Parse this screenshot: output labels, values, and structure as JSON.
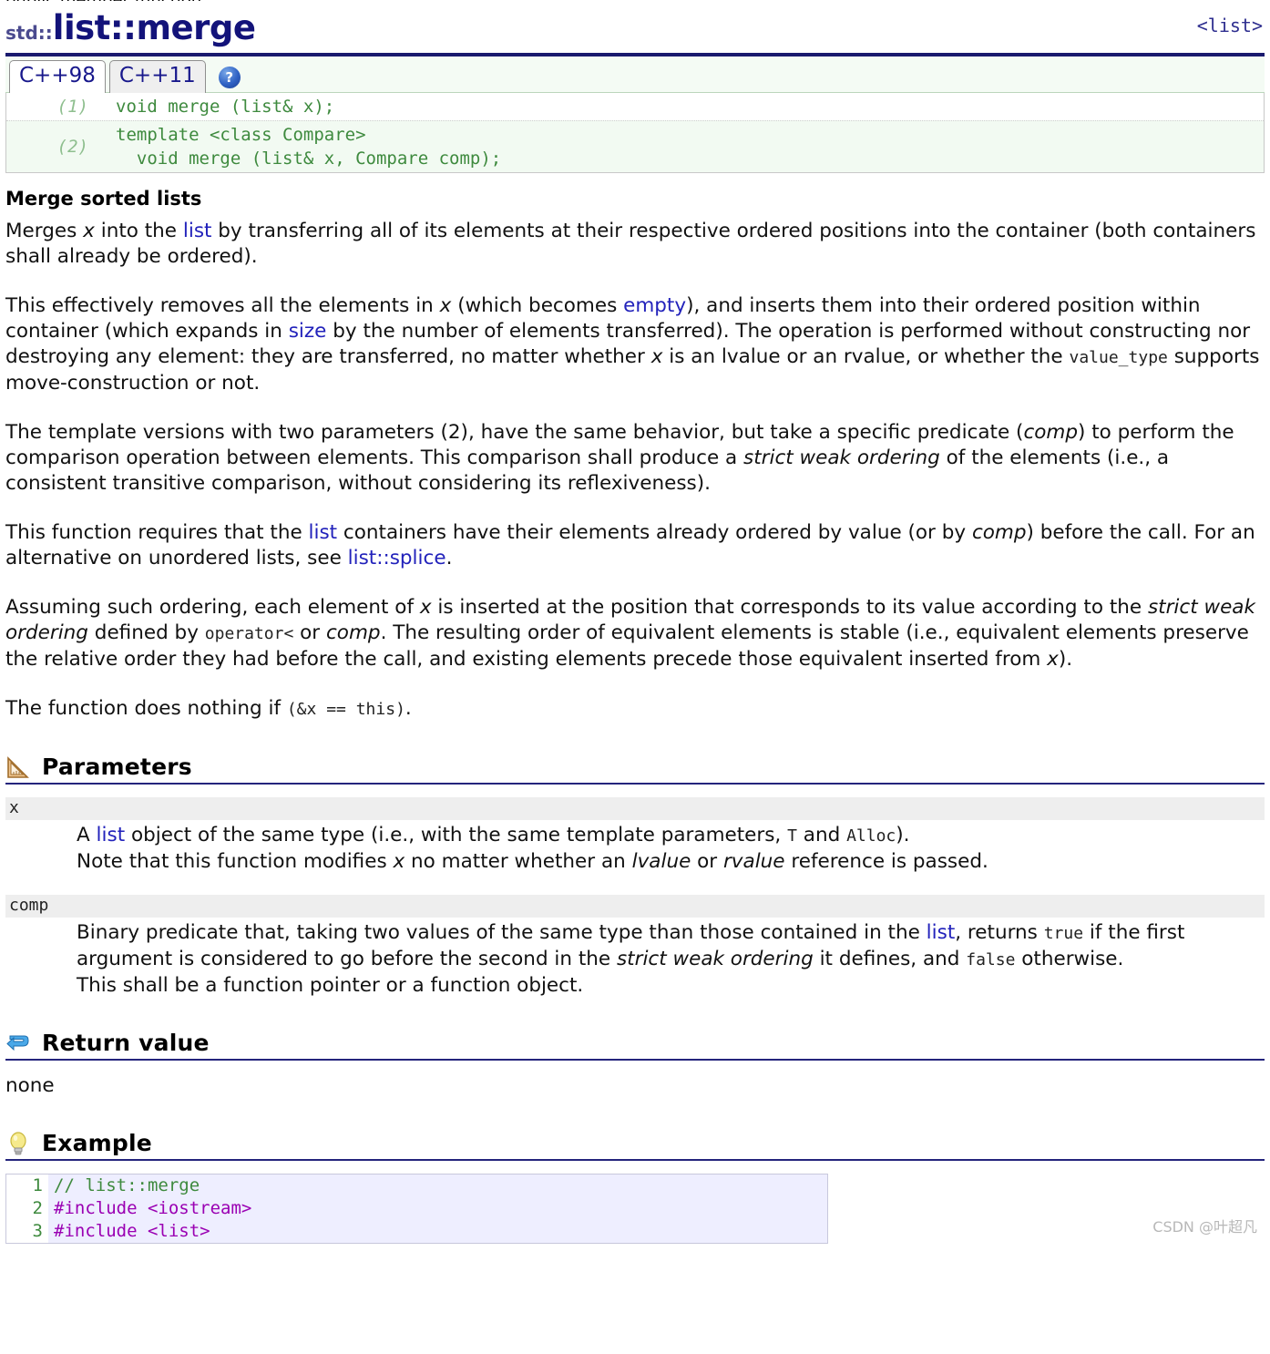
{
  "header": {
    "kind": "public member function",
    "namespace": "std::",
    "title": "list::merge",
    "header_file": "<list>"
  },
  "tabs": {
    "items": [
      {
        "label": "C++98",
        "active": true
      },
      {
        "label": "C++11",
        "active": false
      }
    ],
    "help_glyph": "?"
  },
  "prototypes": [
    {
      "num": "(1)",
      "code": "void merge (list& x);"
    },
    {
      "num": "(2)",
      "code": "template <class Compare>\n  void merge (list& x, Compare comp);"
    }
  ],
  "summary_heading": "Merge sorted lists",
  "paragraphs": {
    "p1_a": "Merges ",
    "p1_x": "x",
    "p1_b": " into the ",
    "p1_link": "list",
    "p1_c": " by transferring all of its elements at their respective ordered positions into the container (both containers shall already be ordered).",
    "p2_a": "This effectively removes all the elements in ",
    "p2_x": "x",
    "p2_b": " (which becomes ",
    "p2_link1": "empty",
    "p2_c": "), and inserts them into their ordered position within container (which expands in ",
    "p2_link2": "size",
    "p2_d": " by the number of elements transferred). The operation is performed without constructing nor destroying any element: they are transferred, no matter whether ",
    "p2_x2": "x",
    "p2_e": " is an lvalue or an rvalue, or whether the ",
    "p2_mono": "value_type",
    "p2_f": " supports move-construction or not.",
    "p3_a": "The template versions with two parameters (2), have the same behavior, but take a specific predicate (",
    "p3_i1": "comp",
    "p3_b": ") to perform the comparison operation between elements. This comparison shall produce a ",
    "p3_i2": "strict weak ordering",
    "p3_c": " of the elements (i.e., a consistent transitive comparison, without considering its reflexiveness).",
    "p4_a": "This function requires that the ",
    "p4_link1": "list",
    "p4_b": " containers have their elements already ordered by value (or by ",
    "p4_i1": "comp",
    "p4_c": ") before the call. For an alternative on unordered lists, see ",
    "p4_link2": "list::splice",
    "p4_d": ".",
    "p5_a": "Assuming such ordering, each element of ",
    "p5_x": "x",
    "p5_b": " is inserted at the position that corresponds to its value according to the ",
    "p5_i1": "strict weak ordering",
    "p5_c": " defined by ",
    "p5_mono": "operator<",
    "p5_d": " or ",
    "p5_i2": "comp",
    "p5_e": ". The resulting order of equivalent elements is stable (i.e., equivalent elements preserve the relative order they had before the call, and existing elements precede those equivalent inserted from ",
    "p5_x2": "x",
    "p5_f": ").",
    "p6_a": "The function does nothing if ",
    "p6_mono1": "(&x == ",
    "p6_mono2": "this",
    "p6_mono3": ")",
    "p6_b": "."
  },
  "sections": {
    "parameters": {
      "title": "Parameters",
      "icon": "ruler-icon"
    },
    "return_value": {
      "title": "Return value",
      "icon": "return-arrow-icon",
      "value": "none"
    },
    "example": {
      "title": "Example",
      "icon": "lightbulb-icon"
    }
  },
  "parameters": [
    {
      "name": "x",
      "d1_a": "A ",
      "d1_link": "list",
      "d1_b": " object of the same type (i.e., with the same template parameters, ",
      "d1_m1": "T",
      "d1_c": " and ",
      "d1_m2": "Alloc",
      "d1_d": ").",
      "d2_a": "Note that this function modifies ",
      "d2_x": "x",
      "d2_b": " no matter whether an ",
      "d2_i1": "lvalue",
      "d2_c": " or ",
      "d2_i2": "rvalue",
      "d2_d": " reference is passed."
    },
    {
      "name": "comp",
      "d1_a": "Binary predicate that, taking two values of the same type than those contained in the ",
      "d1_link": "list",
      "d1_b": ", returns ",
      "d1_m1": "true",
      "d1_c": " if the first argument is considered to go before the second in the ",
      "d1_i1": "strict weak ordering",
      "d1_d": " it defines, and ",
      "d1_m2": "false",
      "d1_e": " otherwise.",
      "d2_a": "This shall be a function pointer or a function object."
    }
  ],
  "code_sample": {
    "lines": [
      {
        "no": "1",
        "comment": "// list::merge",
        "pre": "",
        "hdr": ""
      },
      {
        "no": "2",
        "comment": "",
        "pre": "#include ",
        "hdr": "<iostream>"
      },
      {
        "no": "3",
        "comment": "",
        "pre": "#include ",
        "hdr": "<list>"
      }
    ]
  },
  "watermark": "CSDN @叶超凡",
  "colors": {
    "title": "#13137a",
    "link": "#2222bb",
    "code_green": "#3e8a3e",
    "rule": "#1a1a6e"
  }
}
